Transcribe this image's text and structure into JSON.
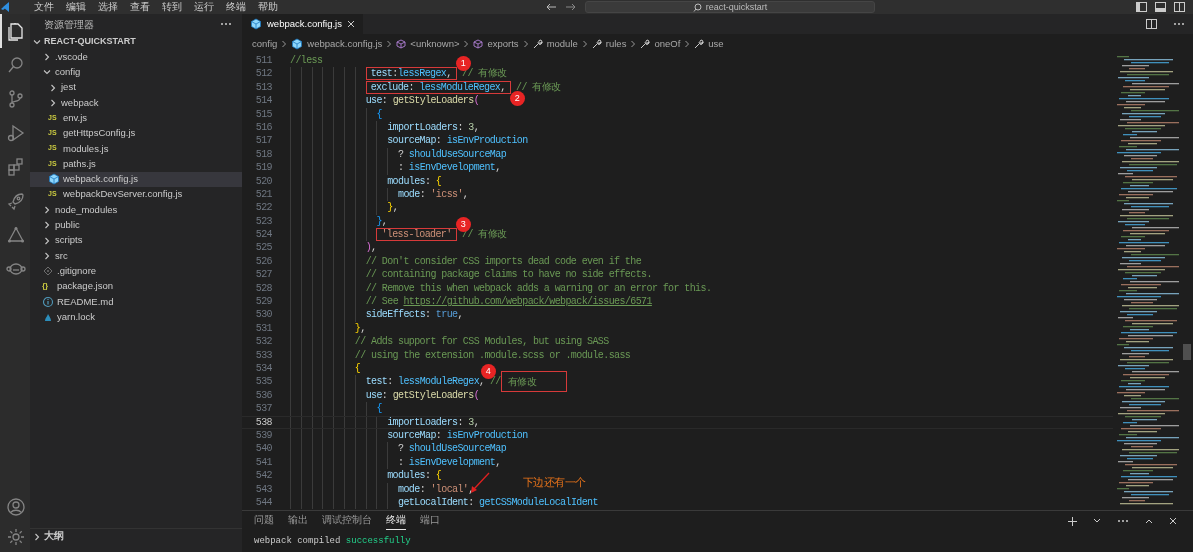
{
  "title_bar": {
    "menu": [
      "文件",
      "编辑",
      "选择",
      "查看",
      "转到",
      "运行",
      "终端",
      "帮助"
    ],
    "search": "react-quickstart"
  },
  "activity_bar": [
    {
      "kind": "files",
      "selected": true
    },
    {
      "kind": "search",
      "selected": false
    },
    {
      "kind": "source-control",
      "selected": false
    },
    {
      "kind": "run",
      "selected": false
    },
    {
      "kind": "extensions",
      "selected": false
    },
    {
      "kind": "rocket",
      "selected": false
    },
    {
      "kind": "triangle",
      "selected": false
    },
    {
      "kind": "monkey",
      "selected": false
    }
  ],
  "activity_bar_bottom": [
    {
      "kind": "account",
      "selected": false
    },
    {
      "kind": "settings",
      "selected": false
    }
  ],
  "explorer": {
    "title": "资源管理器",
    "root": {
      "label": "REACT-QUICKSTART",
      "expanded": true,
      "children": [
        {
          "label": ".vscode",
          "kind": "folder",
          "expanded": false,
          "selected": false
        },
        {
          "label": "config",
          "kind": "folder",
          "expanded": true,
          "selected": false,
          "children": [
            {
              "label": "jest",
              "kind": "folder",
              "expanded": false,
              "selected": false
            },
            {
              "label": "webpack",
              "kind": "folder",
              "expanded": false,
              "selected": false
            },
            {
              "label": "env.js",
              "kind": "js",
              "icon_text": "JS",
              "selected": false
            },
            {
              "label": "getHttpsConfig.js",
              "kind": "js",
              "icon_text": "JS",
              "selected": false
            },
            {
              "label": "modules.js",
              "kind": "js",
              "icon_text": "JS",
              "selected": false
            },
            {
              "label": "paths.js",
              "kind": "js",
              "icon_text": "JS",
              "selected": false
            },
            {
              "label": "webpack.config.js",
              "kind": "webpack",
              "selected": true
            },
            {
              "label": "webpackDevServer.config.js",
              "kind": "js",
              "icon_text": "JS",
              "selected": false
            }
          ]
        },
        {
          "label": "node_modules",
          "kind": "folder",
          "expanded": false,
          "selected": false
        },
        {
          "label": "public",
          "kind": "folder",
          "expanded": false,
          "selected": false
        },
        {
          "label": "scripts",
          "kind": "folder",
          "expanded": false,
          "selected": false
        },
        {
          "label": "src",
          "kind": "folder",
          "expanded": false,
          "selected": false
        },
        {
          "label": ".gitignore",
          "kind": "git",
          "selected": false
        },
        {
          "label": "package.json",
          "kind": "json",
          "icon_text": "{}",
          "selected": false
        },
        {
          "label": "README.md",
          "kind": "info",
          "selected": false
        },
        {
          "label": "yarn.lock",
          "kind": "yarn",
          "selected": false
        }
      ]
    },
    "outline": {
      "label": "大纲",
      "expanded": false
    }
  },
  "tabs": [
    {
      "label": "webpack.config.js",
      "kind": "webpack",
      "selected": true
    }
  ],
  "breadcrumb": [
    {
      "label": "config",
      "kind": "plain"
    },
    {
      "label": "webpack.config.js",
      "kind": "webpack"
    },
    {
      "label": "<unknown>",
      "kind": "symbol"
    },
    {
      "label": "exports",
      "kind": "symbol"
    },
    {
      "label": "module",
      "kind": "property"
    },
    {
      "label": "rules",
      "kind": "property"
    },
    {
      "label": "oneOf",
      "kind": "property"
    },
    {
      "label": "use",
      "kind": "property"
    }
  ],
  "code": [
    {
      "num": "511",
      "current": false,
      "tokens": [
        {
          "kind": "cmt",
          "text": "//less"
        }
      ]
    },
    {
      "num": "512",
      "current": false,
      "tokens": [
        {
          "kind": "annotation",
          "marker": "1",
          "marker_below": false,
          "marker_left": false,
          "tokens": [
            {
              "kind": "key",
              "text": "              test"
            },
            {
              "kind": "punct",
              "text": ":"
            },
            {
              "kind": "var",
              "text": "lessRegex"
            },
            {
              "kind": "punct",
              "text": ","
            }
          ]
        },
        {
          "kind": "cmt",
          "text": " // 有修改"
        }
      ]
    },
    {
      "num": "513",
      "current": false,
      "tokens": [
        {
          "kind": "annotation",
          "marker": "2",
          "marker_below": true,
          "marker_left": false,
          "tokens": [
            {
              "kind": "key",
              "text": "              exclude"
            },
            {
              "kind": "punct",
              "text": ": "
            },
            {
              "kind": "var",
              "text": "lessModuleRegex"
            },
            {
              "kind": "punct",
              "text": ","
            }
          ]
        },
        {
          "kind": "cmt",
          "text": " // 有修改"
        }
      ]
    },
    {
      "num": "514",
      "current": false,
      "tokens": [
        {
          "kind": "key",
          "text": "              use"
        },
        {
          "kind": "punct",
          "text": ": "
        },
        {
          "kind": "fn",
          "text": "getStyleLoaders"
        },
        {
          "kind": "brace2",
          "text": "("
        }
      ]
    },
    {
      "num": "515",
      "current": false,
      "tokens": [
        {
          "kind": "brace3",
          "text": "                {"
        }
      ]
    },
    {
      "num": "516",
      "current": false,
      "tokens": [
        {
          "kind": "key",
          "text": "                  importLoaders"
        },
        {
          "kind": "punct",
          "text": ": "
        },
        {
          "kind": "num",
          "text": "3"
        },
        {
          "kind": "punct",
          "text": ","
        }
      ]
    },
    {
      "num": "517",
      "current": false,
      "tokens": [
        {
          "kind": "key",
          "text": "                  sourceMap"
        },
        {
          "kind": "punct",
          "text": ": "
        },
        {
          "kind": "var",
          "text": "isEnvProduction"
        }
      ]
    },
    {
      "num": "518",
      "current": false,
      "tokens": [
        {
          "kind": "punct",
          "text": "                    ? "
        },
        {
          "kind": "var",
          "text": "shouldUseSourceMap"
        }
      ]
    },
    {
      "num": "519",
      "current": false,
      "tokens": [
        {
          "kind": "punct",
          "text": "                    : "
        },
        {
          "kind": "var",
          "text": "isEnvDevelopment"
        },
        {
          "kind": "punct",
          "text": ","
        }
      ]
    },
    {
      "num": "520",
      "current": false,
      "tokens": [
        {
          "kind": "key",
          "text": "                  modules"
        },
        {
          "kind": "punct",
          "text": ": "
        },
        {
          "kind": "brace1",
          "text": "{"
        }
      ]
    },
    {
      "num": "521",
      "current": false,
      "tokens": [
        {
          "kind": "key",
          "text": "                    mode"
        },
        {
          "kind": "punct",
          "text": ": "
        },
        {
          "kind": "str",
          "text": "'icss'"
        },
        {
          "kind": "punct",
          "text": ","
        }
      ]
    },
    {
      "num": "522",
      "current": false,
      "tokens": [
        {
          "kind": "brace1",
          "text": "                  }"
        },
        {
          "kind": "punct",
          "text": ","
        }
      ]
    },
    {
      "num": "523",
      "current": false,
      "tokens": [
        {
          "kind": "brace3",
          "text": "                }"
        },
        {
          "kind": "punct",
          "text": ","
        }
      ]
    },
    {
      "num": "524",
      "current": false,
      "tokens": [
        {
          "kind": "annotation",
          "marker": "3",
          "marker_below": false,
          "marker_left": false,
          "tokens": [
            {
              "kind": "str",
              "text": "                'less-loader'"
            }
          ]
        },
        {
          "kind": "cmt",
          "text": " // 有修改"
        }
      ]
    },
    {
      "num": "525",
      "current": false,
      "tokens": [
        {
          "kind": "brace2",
          "text": "              )"
        },
        {
          "kind": "punct",
          "text": ","
        }
      ]
    },
    {
      "num": "526",
      "current": false,
      "tokens": [
        {
          "kind": "cmt",
          "text": "              // Don't consider CSS imports dead code even if the"
        }
      ]
    },
    {
      "num": "527",
      "current": false,
      "tokens": [
        {
          "kind": "cmt",
          "text": "              // containing package claims to have no side effects."
        }
      ]
    },
    {
      "num": "528",
      "current": false,
      "tokens": [
        {
          "kind": "cmt",
          "text": "              // Remove this when webpack adds a warning or an error for this."
        }
      ]
    },
    {
      "num": "529",
      "current": false,
      "tokens": [
        {
          "kind": "cmt",
          "text": "              // See "
        },
        {
          "kind": "link",
          "text": "https://github.com/webpack/webpack/issues/6571"
        }
      ]
    },
    {
      "num": "530",
      "current": false,
      "tokens": [
        {
          "kind": "key",
          "text": "              sideEffects"
        },
        {
          "kind": "punct",
          "text": ": "
        },
        {
          "kind": "bool",
          "text": "true"
        },
        {
          "kind": "punct",
          "text": ","
        }
      ]
    },
    {
      "num": "531",
      "current": false,
      "tokens": [
        {
          "kind": "brace1",
          "text": "            }"
        },
        {
          "kind": "punct",
          "text": ","
        }
      ]
    },
    {
      "num": "532",
      "current": false,
      "tokens": [
        {
          "kind": "cmt",
          "text": "            // Adds support for CSS Modules, but using SASS"
        }
      ]
    },
    {
      "num": "533",
      "current": false,
      "tokens": [
        {
          "kind": "cmt",
          "text": "            // using the extension .module.scss or .module.sass"
        }
      ]
    },
    {
      "num": "534",
      "current": false,
      "tokens": [
        {
          "kind": "brace1",
          "text": "            {"
        }
      ]
    },
    {
      "num": "535",
      "current": false,
      "tokens": [
        {
          "kind": "key",
          "text": "              test"
        },
        {
          "kind": "punct",
          "text": ": "
        },
        {
          "kind": "var",
          "text": "lessModuleRegex"
        },
        {
          "kind": "punct",
          "text": ", "
        },
        {
          "kind": "cmt",
          "text": "//"
        },
        {
          "kind": "annotation",
          "marker": "4",
          "marker_below": false,
          "marker_left": true,
          "tokens": [
            {
              "kind": "cmt",
              "text": " 有修改"
            }
          ]
        }
      ]
    },
    {
      "num": "536",
      "current": false,
      "tokens": [
        {
          "kind": "key",
          "text": "              use"
        },
        {
          "kind": "punct",
          "text": ": "
        },
        {
          "kind": "fn",
          "text": "getStyleLoaders"
        },
        {
          "kind": "brace2",
          "text": "("
        }
      ]
    },
    {
      "num": "537",
      "current": false,
      "tokens": [
        {
          "kind": "brace3",
          "text": "                {"
        }
      ]
    },
    {
      "num": "538",
      "current": true,
      "tokens": [
        {
          "kind": "key",
          "text": "                  importLoaders"
        },
        {
          "kind": "punct",
          "text": ": "
        },
        {
          "kind": "num",
          "text": "3"
        },
        {
          "kind": "punct",
          "text": ","
        }
      ]
    },
    {
      "num": "539",
      "current": false,
      "tokens": [
        {
          "kind": "key",
          "text": "                  sourceMap"
        },
        {
          "kind": "punct",
          "text": ": "
        },
        {
          "kind": "var",
          "text": "isEnvProduction"
        }
      ]
    },
    {
      "num": "540",
      "current": false,
      "tokens": [
        {
          "kind": "punct",
          "text": "                    ? "
        },
        {
          "kind": "var",
          "text": "shouldUseSourceMap"
        }
      ]
    },
    {
      "num": "541",
      "current": false,
      "tokens": [
        {
          "kind": "punct",
          "text": "                    : "
        },
        {
          "kind": "var",
          "text": "isEnvDevelopment"
        },
        {
          "kind": "punct",
          "text": ","
        }
      ]
    },
    {
      "num": "542",
      "current": false,
      "tokens": [
        {
          "kind": "key",
          "text": "                  modules"
        },
        {
          "kind": "punct",
          "text": ": "
        },
        {
          "kind": "brace1",
          "text": "{"
        }
      ]
    },
    {
      "num": "543",
      "current": false,
      "tokens": [
        {
          "kind": "key",
          "text": "                    mode"
        },
        {
          "kind": "punct",
          "text": ": "
        },
        {
          "kind": "str",
          "text": "'local'"
        },
        {
          "kind": "punct",
          "text": ","
        }
      ]
    },
    {
      "num": "544",
      "current": false,
      "tokens": [
        {
          "kind": "key",
          "text": "                    getLocalIdent"
        },
        {
          "kind": "punct",
          "text": ": "
        },
        {
          "kind": "var",
          "text": "getCSSModuleLocalIdent"
        }
      ]
    }
  ],
  "note": {
    "text": "下边还有一个"
  },
  "panel": {
    "tabs": [
      {
        "label": "问题",
        "selected": false
      },
      {
        "label": "输出",
        "selected": false
      },
      {
        "label": "调试控制台",
        "selected": false
      },
      {
        "label": "终端",
        "selected": true
      },
      {
        "label": "端口",
        "selected": false
      }
    ],
    "terminal": [
      {
        "kind": "plain",
        "text": "webpack compiled "
      },
      {
        "kind": "success",
        "text": "successfully"
      }
    ]
  }
}
